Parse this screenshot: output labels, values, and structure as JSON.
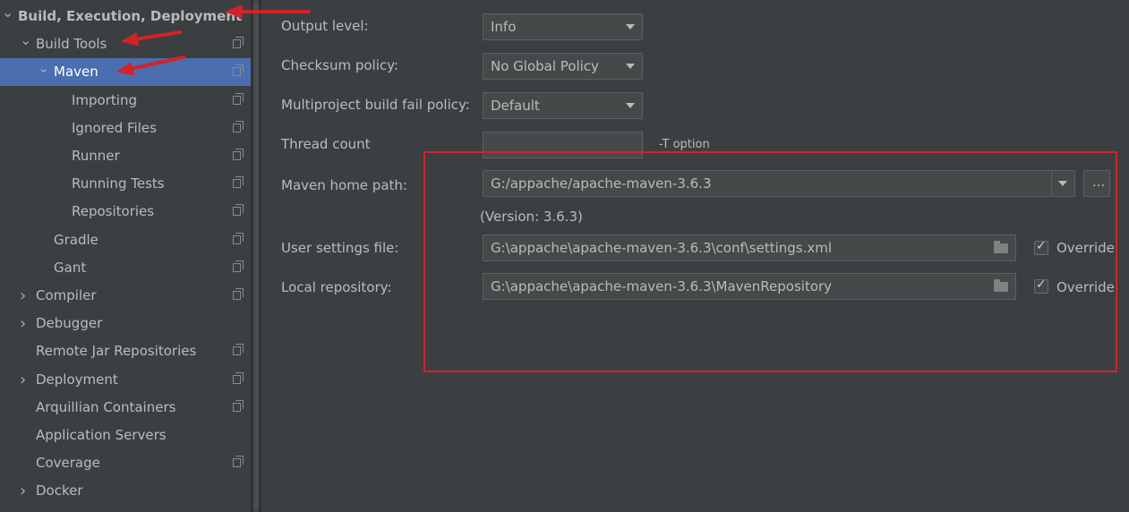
{
  "sidebar": {
    "items": [
      {
        "label": "Build, Execution, Deployment",
        "level": 0,
        "arrow": "down",
        "bold": true,
        "page_icon": false
      },
      {
        "label": "Build Tools",
        "level": 1,
        "arrow": "down",
        "page_icon": true
      },
      {
        "label": "Maven",
        "level": 2,
        "arrow": "down",
        "selected": true,
        "page_icon": true
      },
      {
        "label": "Importing",
        "level": 3,
        "page_icon": true
      },
      {
        "label": "Ignored Files",
        "level": 3,
        "page_icon": true
      },
      {
        "label": "Runner",
        "level": 3,
        "page_icon": true
      },
      {
        "label": "Running Tests",
        "level": 3,
        "page_icon": true
      },
      {
        "label": "Repositories",
        "level": 3,
        "page_icon": true
      },
      {
        "label": "Gradle",
        "level": 2,
        "page_icon": true
      },
      {
        "label": "Gant",
        "level": 2,
        "page_icon": true
      },
      {
        "label": "Compiler",
        "level": 1,
        "arrow": "right",
        "page_icon": true
      },
      {
        "label": "Debugger",
        "level": 1,
        "arrow": "right",
        "page_icon": false
      },
      {
        "label": "Remote Jar Repositories",
        "level": 1,
        "page_icon": true
      },
      {
        "label": "Deployment",
        "level": 1,
        "arrow": "right",
        "page_icon": true
      },
      {
        "label": "Arquillian Containers",
        "level": 1,
        "page_icon": true
      },
      {
        "label": "Application Servers",
        "level": 1,
        "page_icon": false
      },
      {
        "label": "Coverage",
        "level": 1,
        "page_icon": true
      },
      {
        "label": "Docker",
        "level": 1,
        "arrow": "right",
        "page_icon": false
      }
    ]
  },
  "form": {
    "output_level": {
      "label": "Output level:",
      "value": "Info"
    },
    "checksum_policy": {
      "label": "Checksum policy:",
      "value": "No Global Policy"
    },
    "multiproject_fail_policy": {
      "label": "Multiproject build fail policy:",
      "value": "Default"
    },
    "thread_count": {
      "label": "Thread count",
      "value": "",
      "hint": "-T option"
    },
    "maven_home": {
      "label": "Maven home path:",
      "value": "G:/appache/apache-maven-3.6.3",
      "browse_label": "..."
    },
    "version_text": "(Version: 3.6.3)",
    "user_settings": {
      "label": "User settings file:",
      "value": "G:\\appache\\apache-maven-3.6.3\\conf\\settings.xml",
      "override_label": "Override",
      "override_checked": true
    },
    "local_repository": {
      "label": "Local repository:",
      "value": "G:\\appache\\apache-maven-3.6.3\\MavenRepository",
      "override_label": "Override",
      "override_checked": true
    }
  },
  "colors": {
    "background": "#3c3f41",
    "selection": "#4b6eaf",
    "annotation_red": "#d2232a"
  },
  "icons": {
    "tree_arrow_down": "chevron-down-icon",
    "tree_arrow_right": "chevron-right-icon",
    "settings_page": "page-copy-icon",
    "folder": "folder-icon",
    "checkbox": "checkmark-icon"
  }
}
